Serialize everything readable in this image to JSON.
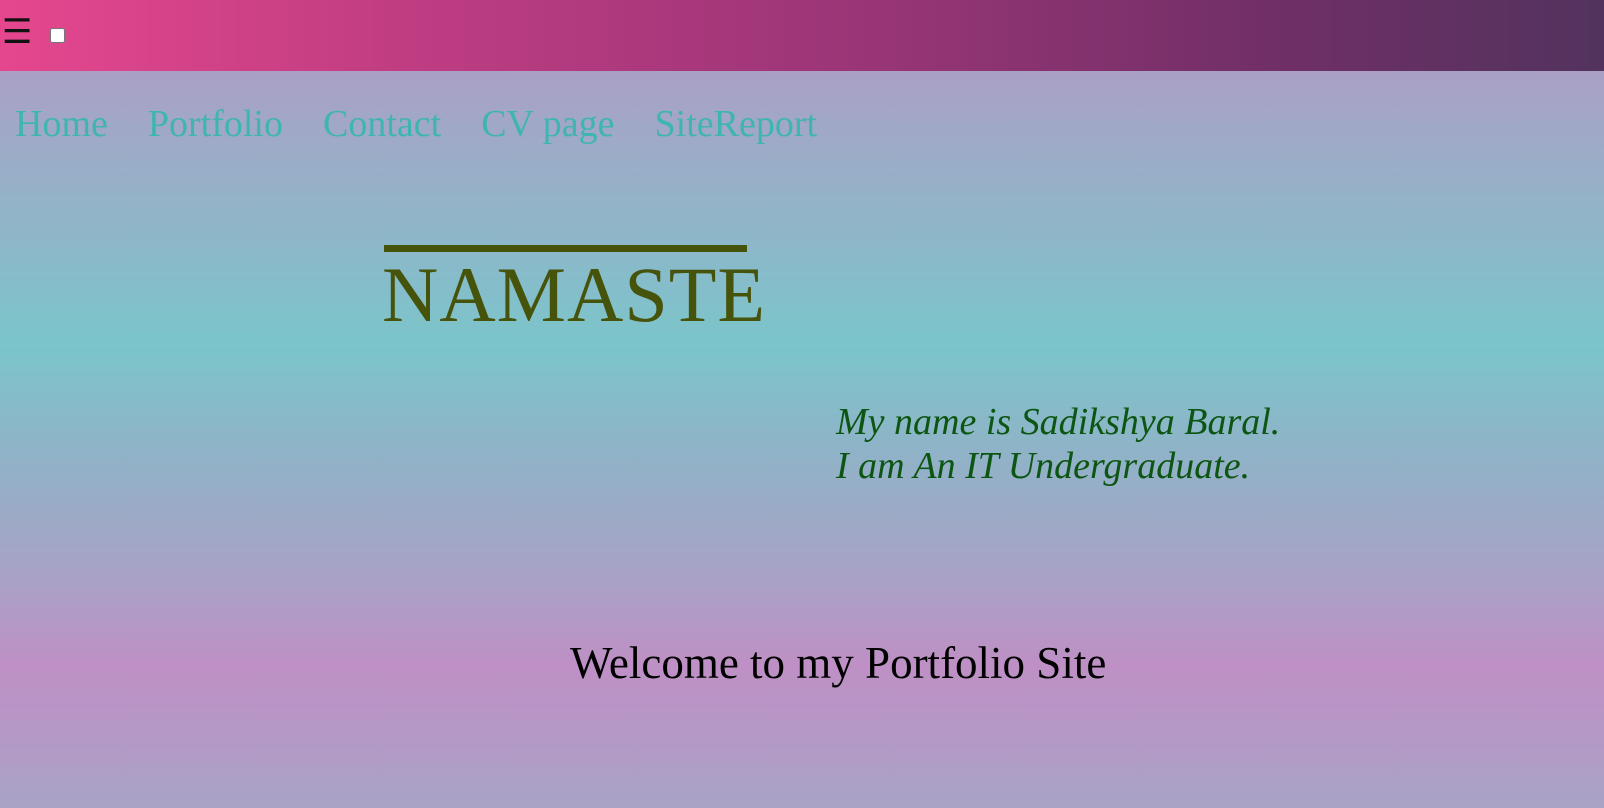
{
  "header": {
    "menu_icon": "☰",
    "colors": {
      "gradient_start": "#e5478e",
      "gradient_end": "#52335e"
    }
  },
  "nav": {
    "items": [
      {
        "label": "Home"
      },
      {
        "label": "Portfolio"
      },
      {
        "label": "Contact"
      },
      {
        "label": "CV page"
      },
      {
        "label": "SiteReport"
      }
    ],
    "color": "#3fb5b2"
  },
  "hero": {
    "title": "NAMASTE",
    "title_color": "#46530b",
    "intro_line1": "My name is Sadikshya Baral.",
    "intro_line2": "I am An IT Undergraduate.",
    "intro_color": "#0d5512"
  },
  "footer": {
    "welcome": "Welcome to my Portfolio Site"
  }
}
